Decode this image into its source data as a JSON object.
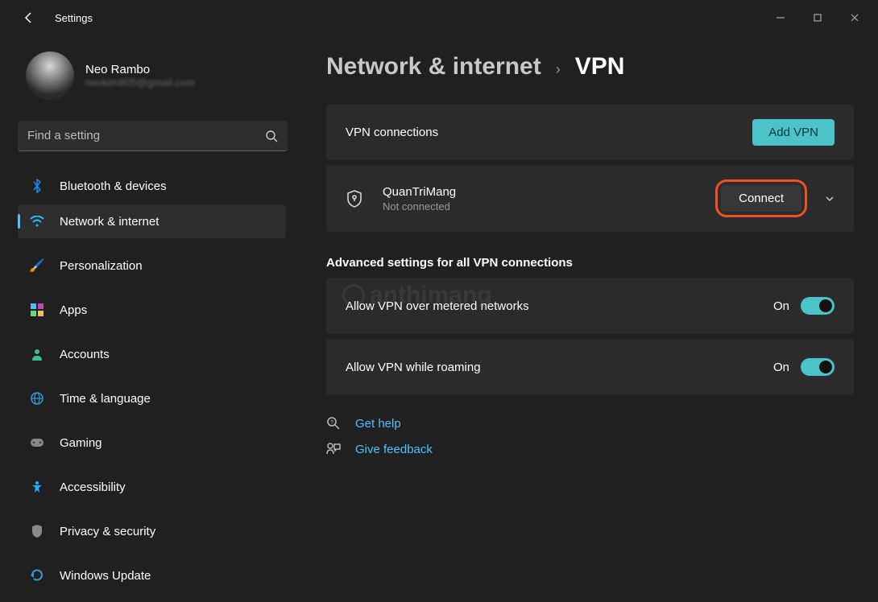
{
  "app": {
    "title": "Settings"
  },
  "user": {
    "name": "Neo Rambo",
    "email": "neokim805@gmail.com"
  },
  "search": {
    "placeholder": "Find a setting"
  },
  "nav": {
    "items": [
      {
        "label": "Bluetooth & devices"
      },
      {
        "label": "Network & internet"
      },
      {
        "label": "Personalization"
      },
      {
        "label": "Apps"
      },
      {
        "label": "Accounts"
      },
      {
        "label": "Time & language"
      },
      {
        "label": "Gaming"
      },
      {
        "label": "Accessibility"
      },
      {
        "label": "Privacy & security"
      },
      {
        "label": "Windows Update"
      }
    ],
    "selected_index": 1
  },
  "breadcrumb": {
    "parent": "Network & internet",
    "current": "VPN"
  },
  "vpn": {
    "connections_header": "VPN connections",
    "add_button": "Add VPN",
    "item": {
      "name": "QuanTriMang",
      "status": "Not connected",
      "action": "Connect"
    }
  },
  "advanced": {
    "header": "Advanced settings for all VPN connections",
    "items": [
      {
        "label": "Allow VPN over metered networks",
        "state": "On",
        "on": true
      },
      {
        "label": "Allow VPN while roaming",
        "state": "On",
        "on": true
      }
    ]
  },
  "footer": {
    "help": "Get help",
    "feedback": "Give feedback"
  }
}
